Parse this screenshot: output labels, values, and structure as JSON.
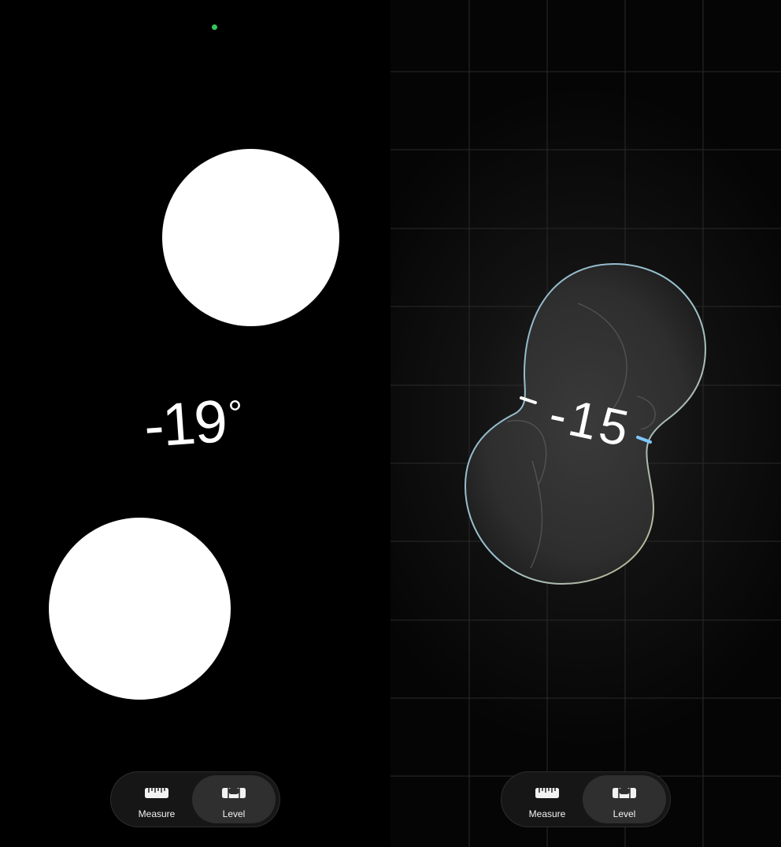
{
  "screens": [
    {
      "angle_value": "-19",
      "degree_symbol": "°",
      "status_indicator_color": "#34c759",
      "tabs": [
        {
          "label": "Measure",
          "icon": "ruler-icon",
          "active": false
        },
        {
          "label": "Level",
          "icon": "level-icon",
          "active": true
        }
      ]
    },
    {
      "angle_value": "-15",
      "tabs": [
        {
          "label": "Measure",
          "icon": "ruler-icon",
          "active": false
        },
        {
          "label": "Level",
          "icon": "level-icon",
          "active": true
        }
      ]
    }
  ],
  "colors": {
    "background": "#000000",
    "disc": "#ffffff",
    "active_tab": "#2f2f2f",
    "tabbar": "#161616",
    "text": "#f2f2f2"
  }
}
